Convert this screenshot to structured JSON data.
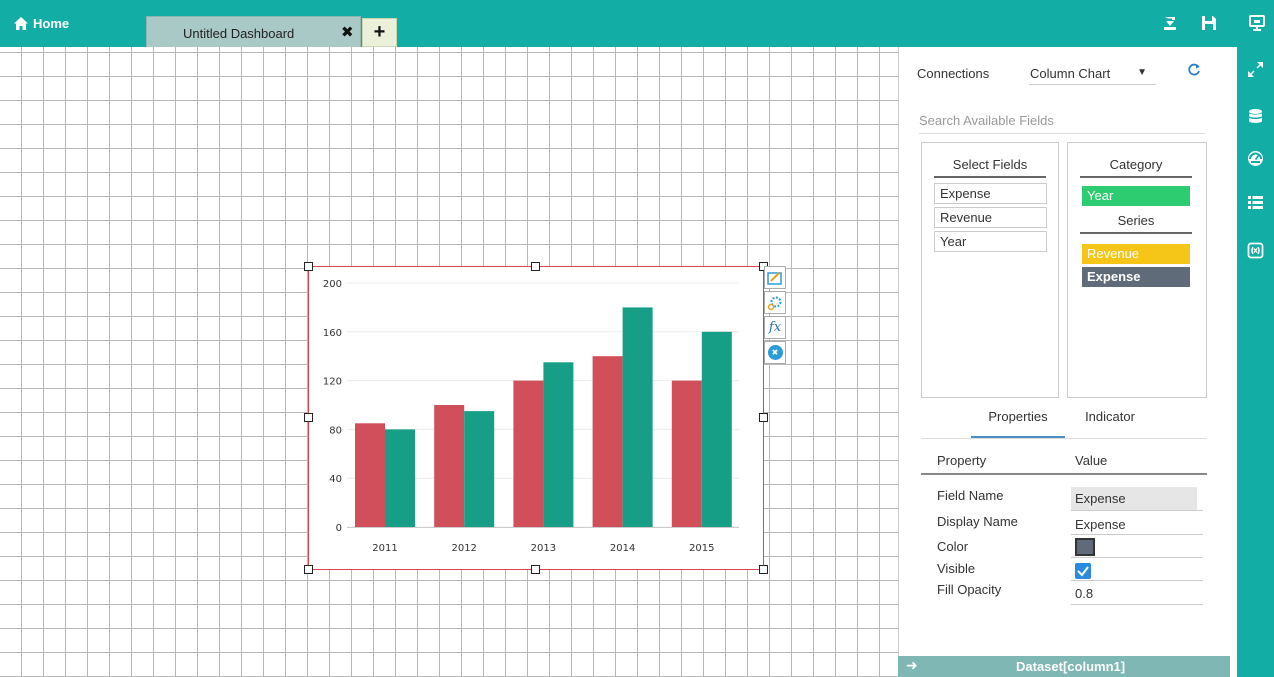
{
  "topbar": {
    "home_label": "Home",
    "tab_label": "Untitled Dashboard",
    "tab_close": "✖",
    "tab_add": "+",
    "icons": [
      "export-icon",
      "save-icon",
      "preview-icon"
    ]
  },
  "rightbar": {
    "icons": [
      "expand-icon",
      "database-icon",
      "dashboard-icon",
      "list-icon",
      "variable-icon"
    ]
  },
  "widget": {
    "tools": [
      "edit-chart-icon",
      "settings-icon",
      "formula-icon",
      "remove-icon"
    ],
    "formula_glyph": "fx",
    "remove_glyph": "✖"
  },
  "chart_data": {
    "type": "bar",
    "categories": [
      "2011",
      "2012",
      "2013",
      "2014",
      "2015"
    ],
    "series": [
      {
        "name": "Revenue",
        "values": [
          85,
          100,
          120,
          140,
          120
        ],
        "color": "#d14f5b"
      },
      {
        "name": "Expense",
        "values": [
          80,
          95,
          135,
          180,
          160
        ],
        "color": "#179e86"
      }
    ],
    "yticks": [
      "0",
      "40",
      "80",
      "120",
      "160",
      "200"
    ],
    "ylim": [
      0,
      200
    ],
    "grid": true
  },
  "panel": {
    "connections_label": "Connections",
    "chart_type": "Column Chart",
    "chart_type_arrow": "▼",
    "search_label": "Search Available Fields",
    "select_fields_title": "Select Fields",
    "fields": [
      "Expense",
      "Revenue",
      "Year"
    ],
    "category_title": "Category",
    "category_items": [
      {
        "label": "Year",
        "color": "#2ecc71"
      }
    ],
    "series_title": "Series",
    "series_items": [
      {
        "label": "Revenue",
        "color": "#f5c518"
      },
      {
        "label": "Expense",
        "color": "#5f6b78"
      }
    ],
    "tabs": [
      "Properties",
      "Indicator"
    ],
    "property_header": "Property",
    "value_header": "Value",
    "properties": [
      {
        "key": "Field Name",
        "value": "Expense"
      },
      {
        "key": "Display Name",
        "value": "Expense"
      },
      {
        "key": "Color",
        "value": "#5f6b78"
      },
      {
        "key": "Visible",
        "value": "checked"
      },
      {
        "key": "Fill Opacity",
        "value": "0.8"
      }
    ]
  },
  "dataset": {
    "label": "Dataset[column1]",
    "arrow": "➜"
  }
}
